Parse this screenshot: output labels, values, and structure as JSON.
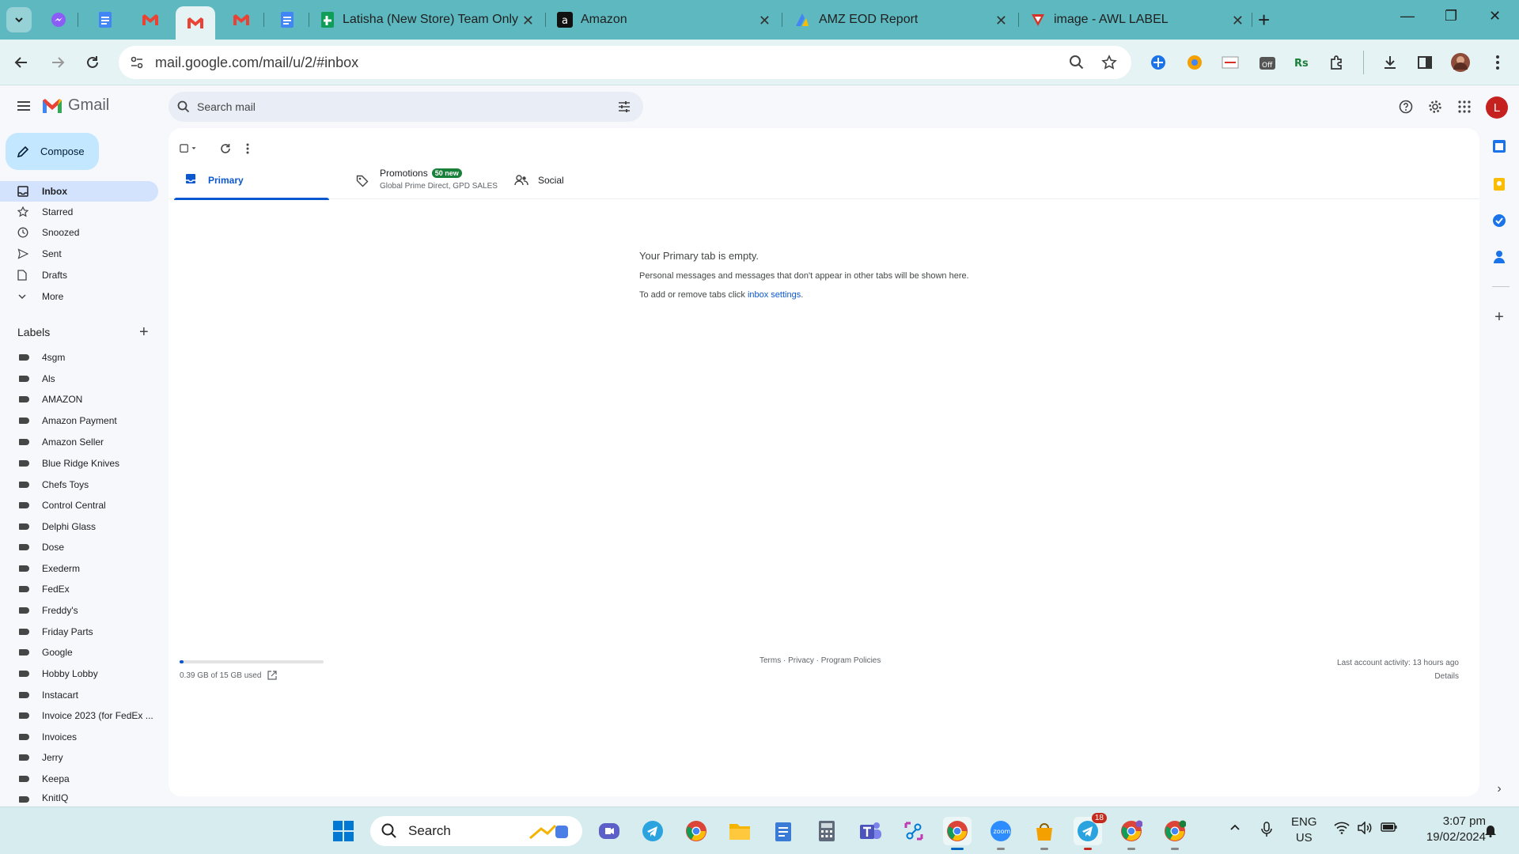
{
  "browser": {
    "tabs": [
      {
        "title": "Latisha (New Store) Team Only",
        "icon": "sheets-icon"
      },
      {
        "title": "Amazon",
        "icon": "amazon-icon"
      },
      {
        "title": "AMZ EOD Report",
        "icon": "report-icon"
      },
      {
        "title": "image - AWL LABEL",
        "icon": "awl-icon"
      }
    ],
    "url": "mail.google.com/mail/u/2/#inbox"
  },
  "gmail": {
    "app_name": "Gmail",
    "search_placeholder": "Search mail",
    "avatar_letter": "L",
    "compose_label": "Compose",
    "nav": [
      {
        "label": "Inbox",
        "icon": "inbox-icon",
        "active": true
      },
      {
        "label": "Starred",
        "icon": "star-icon"
      },
      {
        "label": "Snoozed",
        "icon": "clock-icon"
      },
      {
        "label": "Sent",
        "icon": "send-icon"
      },
      {
        "label": "Drafts",
        "icon": "draft-icon"
      },
      {
        "label": "More",
        "icon": "chevron-down-icon"
      }
    ],
    "labels_title": "Labels",
    "labels": [
      "4sgm",
      "Als",
      "AMAZON",
      "Amazon Payment",
      "Amazon Seller",
      "Blue Ridge Knives",
      "Chefs Toys",
      "Control Central",
      "Delphi Glass",
      "Dose",
      "Exederm",
      "FedEx",
      "Freddy's",
      "Friday Parts",
      "Google",
      "Hobby Lobby",
      "Instacart",
      "Invoice 2023 (for FedEx ...",
      "Invoices",
      "Jerry",
      "Keepa",
      "KnitIQ"
    ],
    "category_tabs": {
      "primary": "Primary",
      "promotions": "Promotions",
      "promotions_badge": "50 new",
      "promotions_senders": "Global Prime Direct, GPD SALES",
      "social": "Social"
    },
    "empty_state": {
      "title": "Your Primary tab is empty.",
      "description": "Personal messages and messages that don't appear in other tabs will be shown here.",
      "hint_prefix": "To add or remove tabs click ",
      "hint_link": "inbox settings",
      "hint_suffix": "."
    },
    "storage": {
      "text": "0.39 GB of 15 GB used",
      "fraction": 0.026
    },
    "footer": {
      "links": "Terms · Privacy · Program Policies",
      "last_activity": "Last account activity: 13 hours ago",
      "details": "Details"
    }
  },
  "taskbar": {
    "search_label": "Search",
    "lang_line1": "ENG",
    "lang_line2": "US",
    "time": "3:07 pm",
    "date": "19/02/2024",
    "telegram_badge": "18"
  },
  "colors": {
    "accent": "#0b57d0",
    "tabstrip": "#5db8bf",
    "compose": "#c2e7ff",
    "badge_green": "#188038"
  }
}
